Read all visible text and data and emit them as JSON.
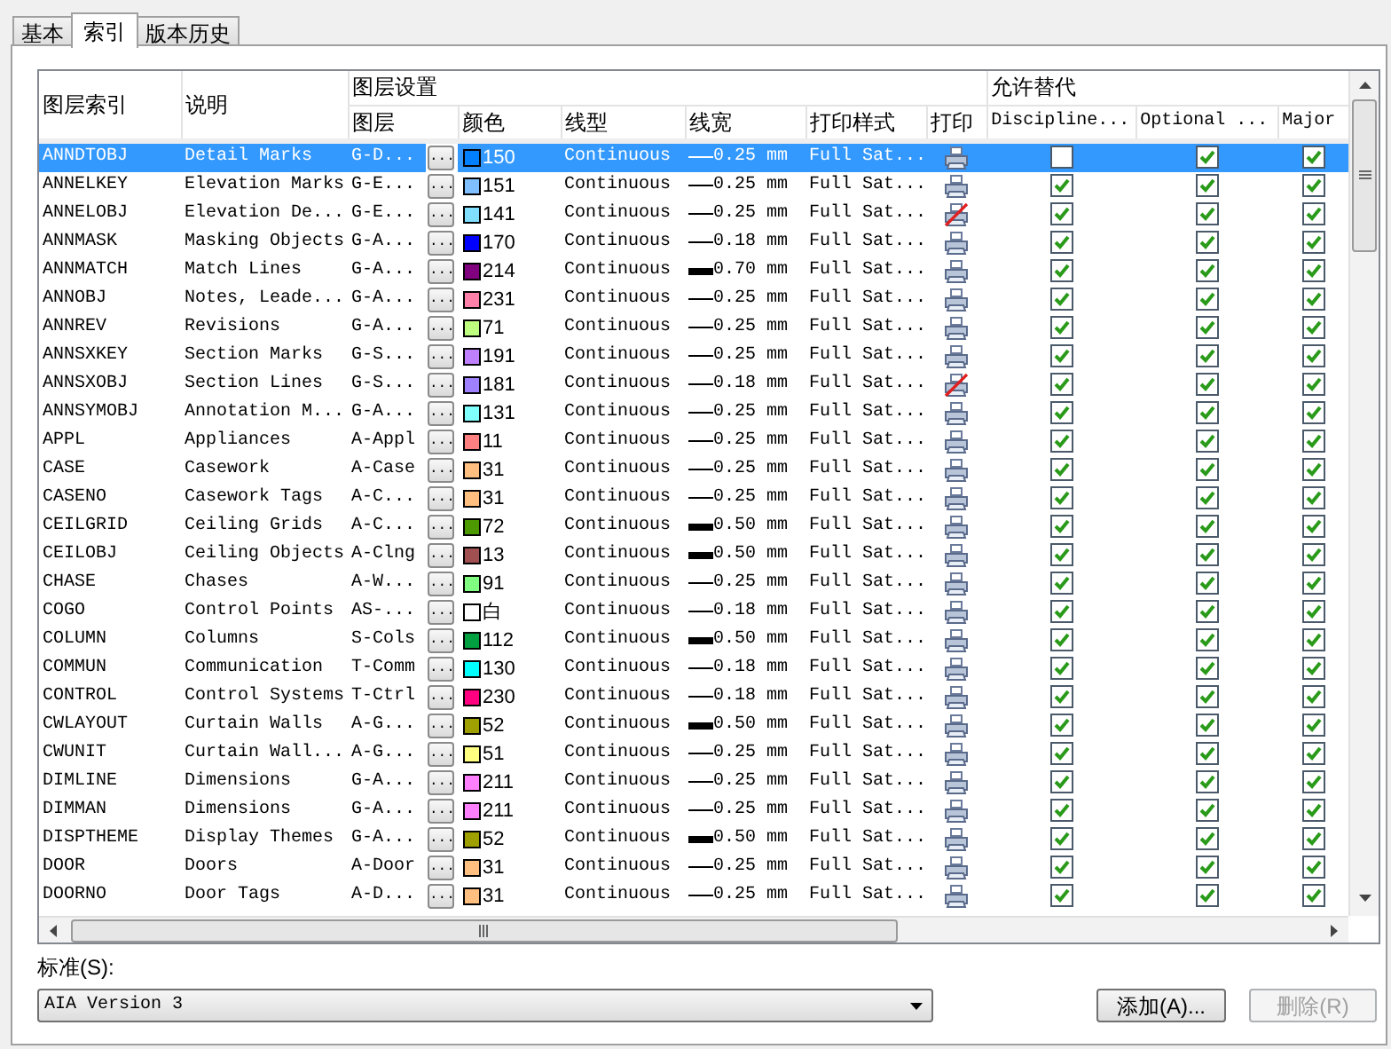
{
  "tabs": [
    {
      "label": "基本",
      "selected": false
    },
    {
      "label": "索引",
      "selected": true
    },
    {
      "label": "版本历史",
      "selected": false
    }
  ],
  "table": {
    "group_headers": {
      "layer_settings": "图层设置",
      "allow_override": "允许替代"
    },
    "columns": [
      "图层索引",
      "说明",
      "图层",
      "颜色",
      "线型",
      "线宽",
      "打印样式",
      "打印",
      "Discipline...",
      "Optional ...",
      "Major"
    ],
    "browse_label": "...",
    "rows": [
      {
        "name": "ANNDTOBJ",
        "description": "Detail Marks",
        "layer": "G-D...",
        "color": "#0080ff",
        "color_label": "150",
        "linetype": "Continuous",
        "heavy": false,
        "lineweight": "0.25 mm",
        "plot_style": "Full Sat...",
        "plot": true,
        "discipline": false,
        "optional": true,
        "major": true,
        "selected": true
      },
      {
        "name": "ANNELKEY",
        "description": "Elevation Marks",
        "layer": "G-E...",
        "color": "#80bfff",
        "color_label": "151",
        "linetype": "Continuous",
        "heavy": false,
        "lineweight": "0.25 mm",
        "plot_style": "Full Sat...",
        "plot": true,
        "discipline": true,
        "optional": true,
        "major": true,
        "selected": false
      },
      {
        "name": "ANNELOBJ",
        "description": "Elevation De...",
        "layer": "G-E...",
        "color": "#80dfff",
        "color_label": "141",
        "linetype": "Continuous",
        "heavy": false,
        "lineweight": "0.25 mm",
        "plot_style": "Full Sat...",
        "plot": false,
        "discipline": true,
        "optional": true,
        "major": true,
        "selected": false
      },
      {
        "name": "ANNMASK",
        "description": "Masking Objects",
        "layer": "G-A...",
        "color": "#0000ff",
        "color_label": "170",
        "linetype": "Continuous",
        "heavy": false,
        "lineweight": "0.18 mm",
        "plot_style": "Full Sat...",
        "plot": true,
        "discipline": true,
        "optional": true,
        "major": true,
        "selected": false
      },
      {
        "name": "ANNMATCH",
        "description": "Match Lines",
        "layer": "G-A...",
        "color": "#800080",
        "color_label": "214",
        "linetype": "Continuous",
        "heavy": true,
        "lineweight": "0.70 mm",
        "plot_style": "Full Sat...",
        "plot": true,
        "discipline": true,
        "optional": true,
        "major": true,
        "selected": false
      },
      {
        "name": "ANNOBJ",
        "description": "Notes, Leade...",
        "layer": "G-A...",
        "color": "#ff80a8",
        "color_label": "231",
        "linetype": "Continuous",
        "heavy": false,
        "lineweight": "0.25 mm",
        "plot_style": "Full Sat...",
        "plot": true,
        "discipline": true,
        "optional": true,
        "major": true,
        "selected": false
      },
      {
        "name": "ANNREV",
        "description": "Revisions",
        "layer": "G-A...",
        "color": "#bfff80",
        "color_label": "71",
        "linetype": "Continuous",
        "heavy": false,
        "lineweight": "0.25 mm",
        "plot_style": "Full Sat...",
        "plot": true,
        "discipline": true,
        "optional": true,
        "major": true,
        "selected": false
      },
      {
        "name": "ANNSXKEY",
        "description": "Section Marks",
        "layer": "G-S...",
        "color": "#bf80ff",
        "color_label": "191",
        "linetype": "Continuous",
        "heavy": false,
        "lineweight": "0.25 mm",
        "plot_style": "Full Sat...",
        "plot": true,
        "discipline": true,
        "optional": true,
        "major": true,
        "selected": false
      },
      {
        "name": "ANNSXOBJ",
        "description": "Section Lines",
        "layer": "G-S...",
        "color": "#9f80ff",
        "color_label": "181",
        "linetype": "Continuous",
        "heavy": false,
        "lineweight": "0.18 mm",
        "plot_style": "Full Sat...",
        "plot": false,
        "discipline": true,
        "optional": true,
        "major": true,
        "selected": false
      },
      {
        "name": "ANNSYMOBJ",
        "description": "Annotation M...",
        "layer": "G-A...",
        "color": "#80ffff",
        "color_label": "131",
        "linetype": "Continuous",
        "heavy": false,
        "lineweight": "0.25 mm",
        "plot_style": "Full Sat...",
        "plot": true,
        "discipline": true,
        "optional": true,
        "major": true,
        "selected": false
      },
      {
        "name": "APPL",
        "description": "Appliances",
        "layer": "A-Appl",
        "color": "#ff8080",
        "color_label": "11",
        "linetype": "Continuous",
        "heavy": false,
        "lineweight": "0.25 mm",
        "plot_style": "Full Sat...",
        "plot": true,
        "discipline": true,
        "optional": true,
        "major": true,
        "selected": false
      },
      {
        "name": "CASE",
        "description": "Casework",
        "layer": "A-Case",
        "color": "#ffbf80",
        "color_label": "31",
        "linetype": "Continuous",
        "heavy": false,
        "lineweight": "0.25 mm",
        "plot_style": "Full Sat...",
        "plot": true,
        "discipline": true,
        "optional": true,
        "major": true,
        "selected": false
      },
      {
        "name": "CASENO",
        "description": "Casework Tags",
        "layer": "A-C...",
        "color": "#ffbf80",
        "color_label": "31",
        "linetype": "Continuous",
        "heavy": false,
        "lineweight": "0.25 mm",
        "plot_style": "Full Sat...",
        "plot": true,
        "discipline": true,
        "optional": true,
        "major": true,
        "selected": false
      },
      {
        "name": "CEILGRID",
        "description": "Ceiling Grids",
        "layer": "A-C...",
        "color": "#4c9900",
        "color_label": "72",
        "linetype": "Continuous",
        "heavy": true,
        "lineweight": "0.50 mm",
        "plot_style": "Full Sat...",
        "plot": true,
        "discipline": true,
        "optional": true,
        "major": true,
        "selected": false
      },
      {
        "name": "CEILOBJ",
        "description": "Ceiling Objects",
        "layer": "A-Clng",
        "color": "#a05050",
        "color_label": "13",
        "linetype": "Continuous",
        "heavy": true,
        "lineweight": "0.50 mm",
        "plot_style": "Full Sat...",
        "plot": true,
        "discipline": true,
        "optional": true,
        "major": true,
        "selected": false
      },
      {
        "name": "CHASE",
        "description": "Chases",
        "layer": "A-W...",
        "color": "#80ff80",
        "color_label": "91",
        "linetype": "Continuous",
        "heavy": false,
        "lineweight": "0.25 mm",
        "plot_style": "Full Sat...",
        "plot": true,
        "discipline": true,
        "optional": true,
        "major": true,
        "selected": false
      },
      {
        "name": "COGO",
        "description": "Control Points",
        "layer": "AS-...",
        "color": "#ffffff",
        "color_label": "白",
        "linetype": "Continuous",
        "heavy": false,
        "lineweight": "0.18 mm",
        "plot_style": "Full Sat...",
        "plot": true,
        "discipline": true,
        "optional": true,
        "major": true,
        "selected": false
      },
      {
        "name": "COLUMN",
        "description": "Columns",
        "layer": "S-Cols",
        "color": "#009f40",
        "color_label": "112",
        "linetype": "Continuous",
        "heavy": true,
        "lineweight": "0.50 mm",
        "plot_style": "Full Sat...",
        "plot": true,
        "discipline": true,
        "optional": true,
        "major": true,
        "selected": false
      },
      {
        "name": "COMMUN",
        "description": "Communication",
        "layer": "T-Comm",
        "color": "#00ffff",
        "color_label": "130",
        "linetype": "Continuous",
        "heavy": false,
        "lineweight": "0.18 mm",
        "plot_style": "Full Sat...",
        "plot": true,
        "discipline": true,
        "optional": true,
        "major": true,
        "selected": false
      },
      {
        "name": "CONTROL",
        "description": "Control Systems",
        "layer": "T-Ctrl",
        "color": "#ff0080",
        "color_label": "230",
        "linetype": "Continuous",
        "heavy": false,
        "lineweight": "0.18 mm",
        "plot_style": "Full Sat...",
        "plot": true,
        "discipline": true,
        "optional": true,
        "major": true,
        "selected": false
      },
      {
        "name": "CWLAYOUT",
        "description": "Curtain Walls",
        "layer": "A-G...",
        "color": "#9f9f00",
        "color_label": "52",
        "linetype": "Continuous",
        "heavy": true,
        "lineweight": "0.50 mm",
        "plot_style": "Full Sat...",
        "plot": true,
        "discipline": true,
        "optional": true,
        "major": true,
        "selected": false
      },
      {
        "name": "CWUNIT",
        "description": "Curtain Wall...",
        "layer": "A-G...",
        "color": "#ffff80",
        "color_label": "51",
        "linetype": "Continuous",
        "heavy": false,
        "lineweight": "0.25 mm",
        "plot_style": "Full Sat...",
        "plot": true,
        "discipline": true,
        "optional": true,
        "major": true,
        "selected": false
      },
      {
        "name": "DIMLINE",
        "description": "Dimensions",
        "layer": "G-A...",
        "color": "#ff80ff",
        "color_label": "211",
        "linetype": "Continuous",
        "heavy": false,
        "lineweight": "0.25 mm",
        "plot_style": "Full Sat...",
        "plot": true,
        "discipline": true,
        "optional": true,
        "major": true,
        "selected": false
      },
      {
        "name": "DIMMAN",
        "description": "Dimensions",
        "layer": "G-A...",
        "color": "#ff80ff",
        "color_label": "211",
        "linetype": "Continuous",
        "heavy": false,
        "lineweight": "0.25 mm",
        "plot_style": "Full Sat...",
        "plot": true,
        "discipline": true,
        "optional": true,
        "major": true,
        "selected": false
      },
      {
        "name": "DISPTHEME",
        "description": "Display Themes",
        "layer": "G-A...",
        "color": "#9f9f00",
        "color_label": "52",
        "linetype": "Continuous",
        "heavy": true,
        "lineweight": "0.50 mm",
        "plot_style": "Full Sat...",
        "plot": true,
        "discipline": true,
        "optional": true,
        "major": true,
        "selected": false
      },
      {
        "name": "DOOR",
        "description": "Doors",
        "layer": "A-Door",
        "color": "#ffbf80",
        "color_label": "31",
        "linetype": "Continuous",
        "heavy": false,
        "lineweight": "0.25 mm",
        "plot_style": "Full Sat...",
        "plot": true,
        "discipline": true,
        "optional": true,
        "major": true,
        "selected": false
      },
      {
        "name": "DOORNO",
        "description": "Door Tags",
        "layer": "A-D...",
        "color": "#ffbf80",
        "color_label": "31",
        "linetype": "Continuous",
        "heavy": false,
        "lineweight": "0.25 mm",
        "plot_style": "Full Sat...",
        "plot": true,
        "discipline": true,
        "optional": true,
        "major": true,
        "selected": false
      }
    ]
  },
  "standard": {
    "label": "标准(S):",
    "value": "AIA Version 3"
  },
  "buttons": [
    {
      "label": "添加(A)...",
      "disabled": false
    },
    {
      "label": "删除(R)",
      "disabled": true
    }
  ]
}
